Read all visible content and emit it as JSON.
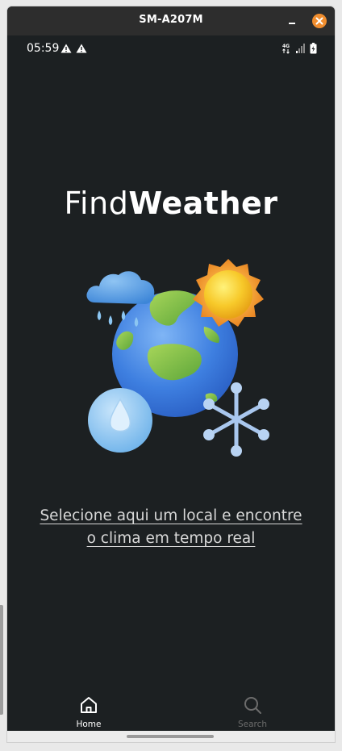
{
  "window": {
    "title": "SM-A207M"
  },
  "status_bar": {
    "time": "05:59",
    "network": "4G"
  },
  "app": {
    "title_light": "Find",
    "title_bold": "Weather",
    "cta_line1": "Selecione aqui um local e encontre",
    "cta_line2": "o clima em tempo real"
  },
  "bottom_nav": {
    "items": [
      {
        "label": "Home",
        "icon": "home-icon",
        "active": true
      },
      {
        "label": "Search",
        "icon": "search-icon",
        "active": false
      }
    ]
  },
  "colors": {
    "background": "#1c2022",
    "titlebar": "#2d2d2d",
    "close_button": "#f08d2e",
    "active_nav": "#ffffff",
    "inactive_nav": "#6c6c6c"
  }
}
